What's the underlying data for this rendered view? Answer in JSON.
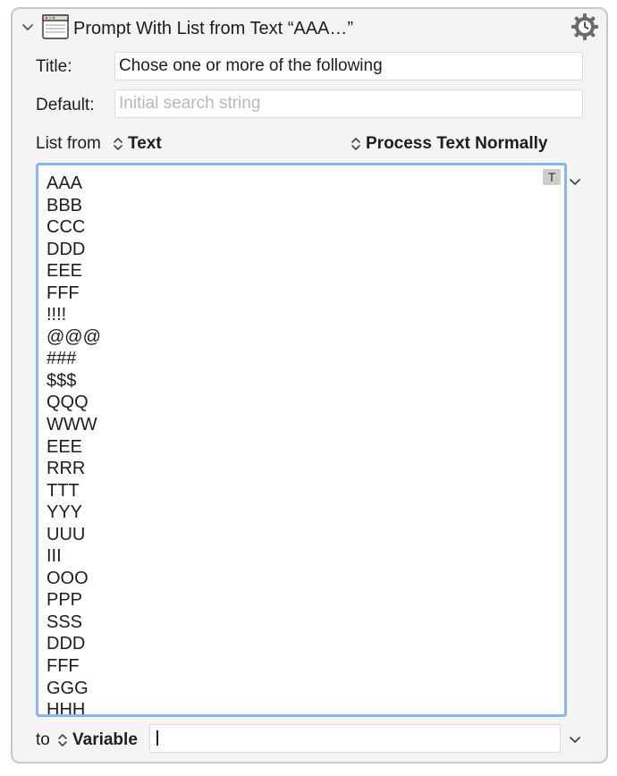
{
  "action": {
    "title": "Prompt With List from Text “AAA…”",
    "collapse_icon": "chevron-down-icon",
    "window_icon": "prompt-window-icon",
    "gear_icon": "gear-clock-icon"
  },
  "title_field": {
    "label": "Title:",
    "value": "Chose one or more of the following"
  },
  "default_field": {
    "label": "Default:",
    "placeholder": "Initial search string"
  },
  "source": {
    "label": "List from",
    "popup": "Text",
    "processing_popup": "Process Text Normally"
  },
  "list_text": {
    "badge": "T",
    "lines": [
      "AAA",
      "BBB",
      "CCC",
      "DDD",
      "EEE",
      "FFF",
      "!!!!",
      "@@@",
      "###",
      "$$$",
      "QQQ",
      "WWW",
      "EEE",
      "RRR",
      "TTT",
      "YYY",
      "UUU",
      "III",
      "OOO",
      "PPP",
      "SSS",
      "DDD",
      "FFF",
      "GGG",
      "HHH"
    ]
  },
  "output": {
    "label": "to",
    "popup": "Variable",
    "value": ""
  },
  "colors": {
    "focus_ring": "#8bb3f0",
    "panel_bg": "#f4f4f4"
  }
}
